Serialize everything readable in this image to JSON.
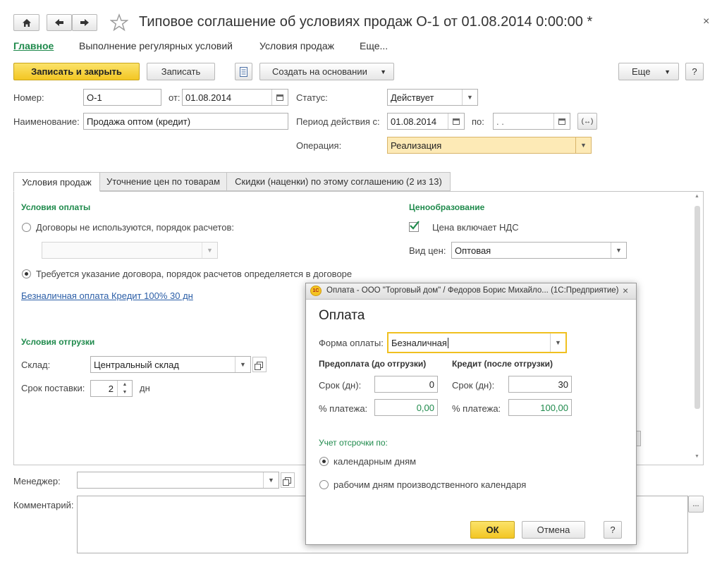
{
  "window": {
    "title": "Типовое соглашение об условиях продаж О-1 от 01.08.2014 0:00:00 *",
    "close": "×",
    "home_icon": "home-icon",
    "back_icon": "back-arrow-icon",
    "forward_icon": "forward-arrow-icon",
    "star_icon": "star-icon"
  },
  "nav_links": [
    "Главное",
    "Выполнение регулярных условий",
    "Условия продаж",
    "Еще..."
  ],
  "toolbar": {
    "save_close": "Записать и закрыть",
    "save": "Записать",
    "create_based": "Создать на основании",
    "more": "Еще",
    "help": "?"
  },
  "header": {
    "number_label": "Номер:",
    "number_value": "О-1",
    "from_label": "от:",
    "from_value": "01.08.2014",
    "status_label": "Статус:",
    "status_value": "Действует",
    "name_label": "Наименование:",
    "name_value": "Продажа оптом (кредит)",
    "period_label": "Период действия с:",
    "period_from": "01.08.2014",
    "period_to_label": "по:",
    "period_to": " .  .",
    "period_btn": "(↔)",
    "operation_label": "Операция:",
    "operation_value": "Реализация"
  },
  "tabs": [
    "Условия продаж",
    "Уточнение цен по товарам",
    "Скидки (наценки) по этому соглашению (2 из 13)"
  ],
  "payment": {
    "heading": "Условия оплаты",
    "opt1": "Договоры не используются, порядок расчетов:",
    "opt2": "Требуется указание договора, порядок расчетов определяется в договоре",
    "link": "Безналичная оплата Кредит 100% 30 дн"
  },
  "pricing": {
    "heading": "Ценообразование",
    "vat_label": "Цена включает НДС",
    "price_type_label": "Вид цен:",
    "price_type_value": "Оптовая"
  },
  "shipment": {
    "heading": "Условия отгрузки",
    "warehouse_label": "Склад:",
    "warehouse_value": "Центральный склад",
    "delivery_label": "Срок поставки:",
    "delivery_value": "2",
    "delivery_unit": "дн"
  },
  "footer": {
    "manager_label": "Менеджер:",
    "comment_label": "Комментарий:",
    "comment_btn": "..."
  },
  "dialog": {
    "title": "Оплата - ООО \"Торговый дом\" / Федоров Борис Михайло...  (1С:Предприятие)",
    "heading": "Оплата",
    "form_label": "Форма оплаты:",
    "form_value": "Безналичная",
    "prepay_heading": "Предоплата (до отгрузки)",
    "credit_heading": "Кредит (после отгрузки)",
    "term_label": "Срок (дн):",
    "percent_label": "% платежа:",
    "prepay_term": "0",
    "prepay_percent": "0,00",
    "credit_term": "30",
    "credit_percent": "100,00",
    "defer_heading": "Учет отсрочки по:",
    "defer_opt1": "календарным дням",
    "defer_opt2": "рабочим дням производственного календаря",
    "ok": "ОК",
    "cancel": "Отмена",
    "help": "?"
  }
}
